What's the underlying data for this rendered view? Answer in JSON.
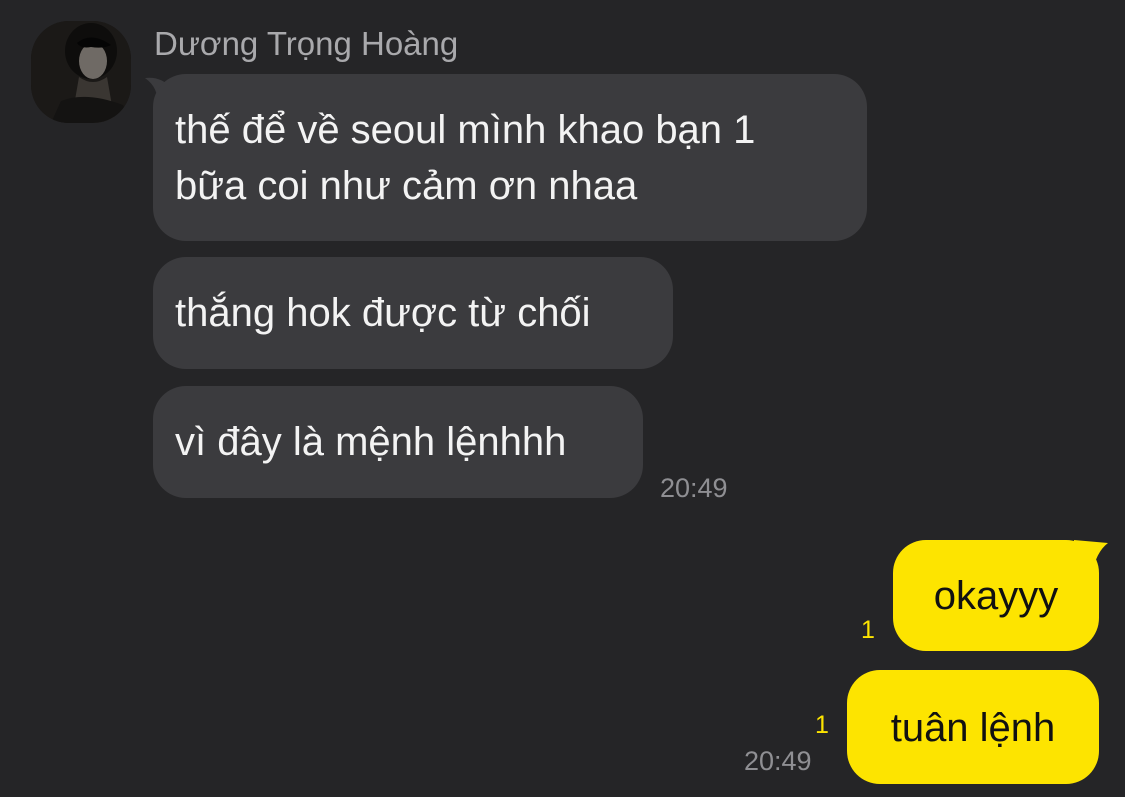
{
  "sender": {
    "name": "Dương Trọng Hoàng"
  },
  "incoming": [
    {
      "line1": "thế để về seoul mình khao bạn 1",
      "line2": "bữa coi như cảm ơn nhaa"
    },
    {
      "text": "thắng hok được từ chối"
    },
    {
      "text": "vì đây là mệnh lệnhhh"
    }
  ],
  "incoming_time": "20:49",
  "outgoing": [
    {
      "text": "okayyy",
      "unread": "1"
    },
    {
      "text": "tuân lệnh",
      "unread": "1"
    }
  ],
  "outgoing_time": "20:49",
  "colors": {
    "background": "#252527",
    "incoming_bubble": "#3b3b3e",
    "outgoing_bubble": "#fde400",
    "unread_count": "#fde400"
  }
}
